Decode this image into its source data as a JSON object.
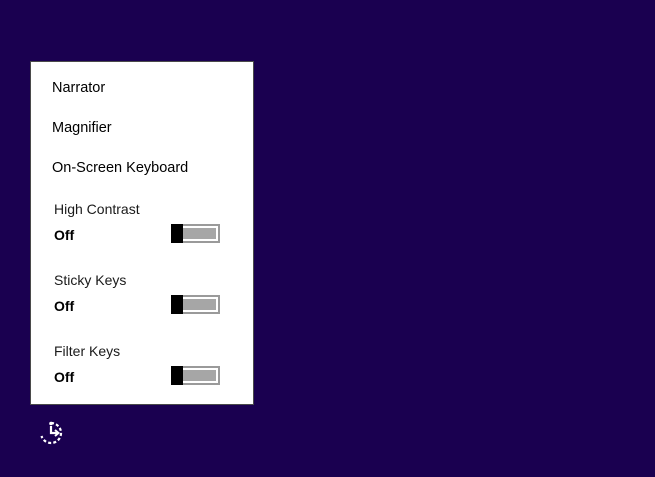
{
  "menu": {
    "narrator": "Narrator",
    "magnifier": "Magnifier",
    "onscreen_keyboard": "On-Screen Keyboard"
  },
  "toggles": [
    {
      "label": "High Contrast",
      "state": "Off",
      "on": false
    },
    {
      "label": "Sticky Keys",
      "state": "Off",
      "on": false
    },
    {
      "label": "Filter Keys",
      "state": "Off",
      "on": false
    }
  ],
  "icons": {
    "ease_of_access": "ease-of-access-icon"
  },
  "colors": {
    "background": "#1a0050",
    "panel": "#ffffff",
    "toggle_track": "#a6a6a6",
    "toggle_thumb": "#000000"
  }
}
